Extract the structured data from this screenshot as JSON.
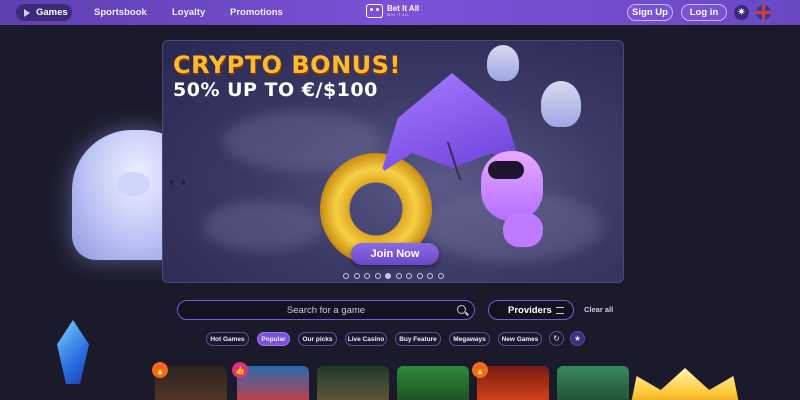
{
  "nav": {
    "games_label": "Games",
    "sportsbook_label": "Sportsbook",
    "loyalty_label": "Loyalty",
    "promotions_label": "Promotions",
    "logo_text": "Bet It All",
    "logo_sub": "WIN IT ALL",
    "signup_label": "Sign Up",
    "login_label": "Log in"
  },
  "hero": {
    "title": "CRYPTO BONUS!",
    "subtitle": "50% UP TO €/$100",
    "cta_label": "Join Now",
    "slide_count": 10,
    "active_slide": 5
  },
  "search": {
    "placeholder": "Search for a game",
    "providers_label": "Providers",
    "clear_label": "Clear all"
  },
  "categories": [
    {
      "label": "Hot Games",
      "active": false
    },
    {
      "label": "Popular",
      "active": true
    },
    {
      "label": "Our picks",
      "active": false
    },
    {
      "label": "Live Casino",
      "active": false
    },
    {
      "label": "Buy Feature",
      "active": false
    },
    {
      "label": "Megaways",
      "active": false
    },
    {
      "label": "New Games",
      "active": false
    }
  ],
  "icons": {
    "history": "history-icon",
    "favorites": "star-icon",
    "theme": "sun-icon",
    "language": "uk-flag-icon"
  },
  "colors": {
    "accent": "#7a52d6",
    "background": "#1b1a2b",
    "bonus_title": "#ffb92e"
  }
}
